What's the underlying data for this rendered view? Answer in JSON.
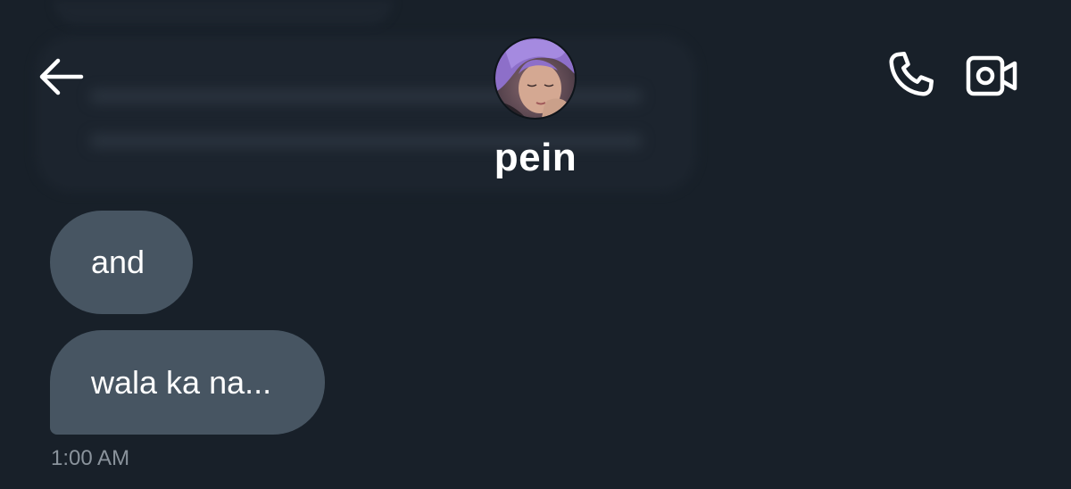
{
  "colors": {
    "background": "#182029",
    "bubble": "#475562",
    "text": "#ffffff",
    "timestamp": "#8a939c"
  },
  "header": {
    "back_icon": "arrow-left-icon",
    "contact_name": "pein",
    "avatar": "profile-photo-purple-hair",
    "call_icon": "phone-icon",
    "video_icon": "video-camera-icon"
  },
  "messages": [
    {
      "text": "and"
    },
    {
      "text": "wala ka na..."
    }
  ],
  "timestamp": "1:00 AM"
}
